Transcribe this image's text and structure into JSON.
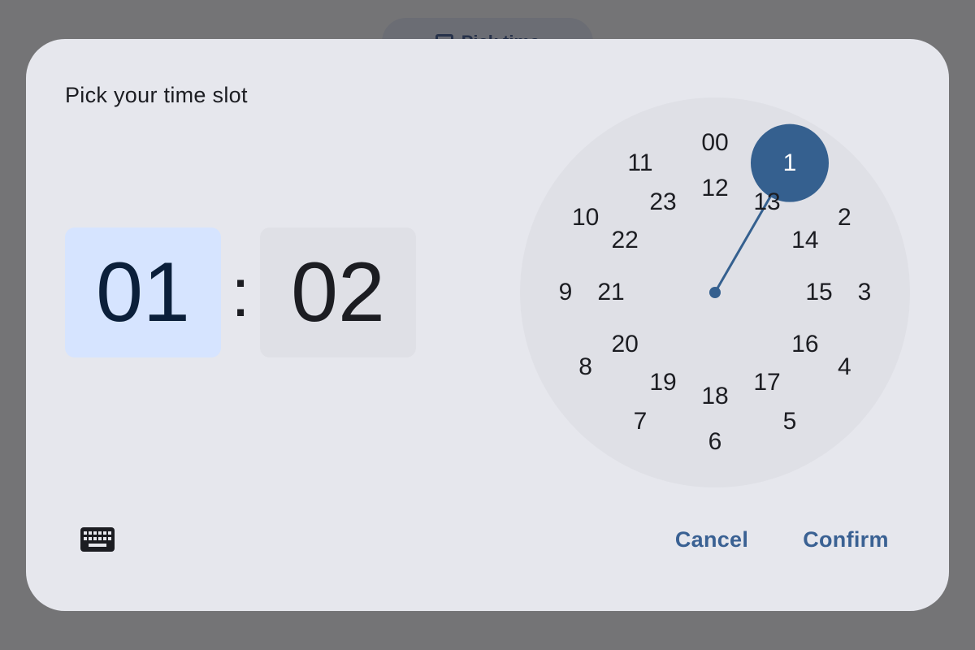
{
  "backdrop": {
    "button_label": "Pick time"
  },
  "dialog": {
    "headline": "Pick your time slot",
    "hour": "01",
    "separator": ":",
    "minute": "02",
    "mode": "hour",
    "selected_hour": 1,
    "dial": {
      "outer_numbers": [
        "00",
        "1",
        "2",
        "3",
        "4",
        "5",
        "6",
        "7",
        "8",
        "9",
        "10",
        "11"
      ],
      "inner_numbers": [
        "12",
        "13",
        "14",
        "15",
        "16",
        "17",
        "18",
        "19",
        "20",
        "21",
        "22",
        "23"
      ]
    },
    "keyboard_icon": "keyboard-icon",
    "cancel_label": "Cancel",
    "confirm_label": "Confirm"
  },
  "colors": {
    "scrim": "#747476",
    "surface": "#e6e7ed",
    "dial_background": "#dfe0e6",
    "selected_hour_background": "#d6e4ff",
    "accent": "#3a6193",
    "selector": "#35608f"
  }
}
